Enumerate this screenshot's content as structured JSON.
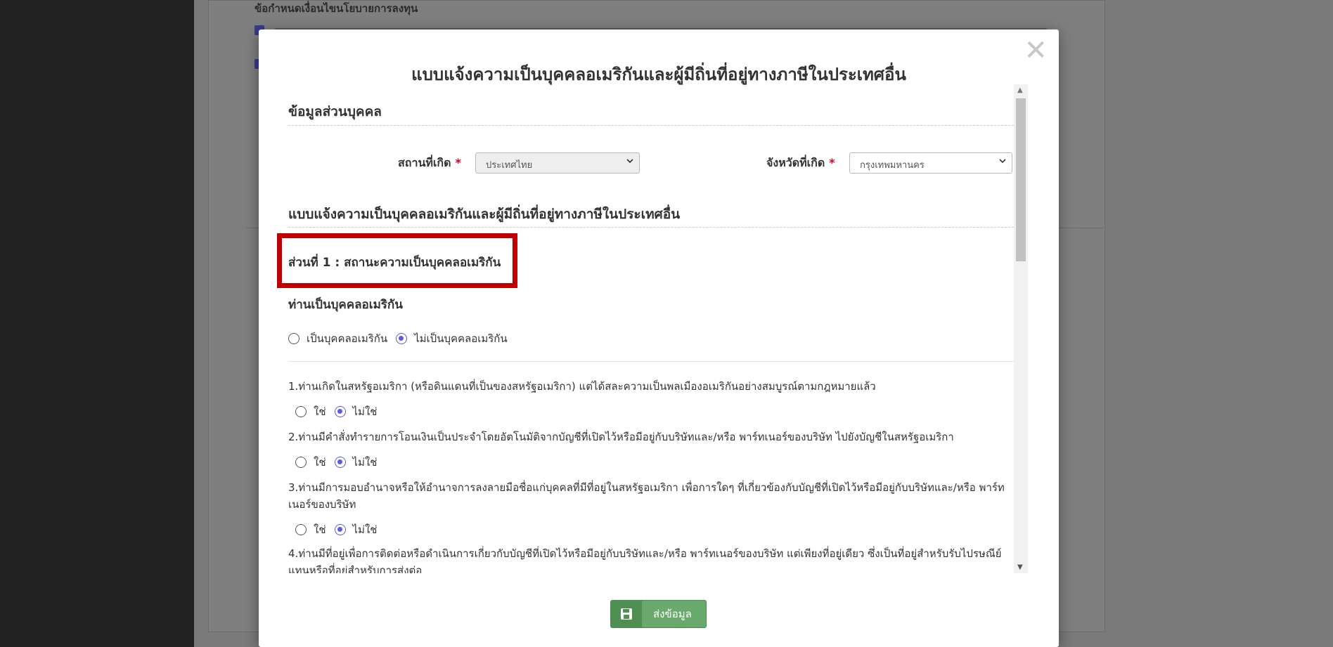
{
  "background": {
    "heading": "ข้อกำหนดเงื่อนไขนโยบายการลงทุน"
  },
  "modal": {
    "title": "แบบแจ้งความเป็นบุคคลอเมริกันและผู้มีถิ่นที่อยู่ทางภาษีในประเทศอื่น",
    "close_symbol": "✕",
    "personal_section_title": "ข้อมูลส่วนบุคคล",
    "birth_place": {
      "label": "สถานที่เกิด",
      "value": "ประเทศไทย"
    },
    "birth_province": {
      "label": "จังหวัดที่เกิด",
      "value": "กรุงเทพมหานคร"
    },
    "required_marker": "*",
    "fatca_section_title": "แบบแจ้งความเป็นบุคคลอเมริกันและผู้มีถิ่นที่อยู่ทางภาษีในประเทศอื่น",
    "part1_title": "ส่วนที่ 1 : สถานะความเป็นบุคคลอเมริกัน",
    "us_person_question": "ท่านเป็นบุคคลอเมริกัน",
    "us_person_options": [
      "เป็นบุคคลอเมริกัน",
      "ไม่เป็นบุคคลอเมริกัน"
    ],
    "us_person_selected": 1,
    "yes_label": "ใช่",
    "no_label": "ไม่ใช่",
    "questions": [
      {
        "text": "1.ท่านเกิดในสหรัฐอเมริกา (หรือดินแดนที่เป็นของสหรัฐอเมริกา) แต่ได้สละความเป็นพลเมืองอเมริกันอย่างสมบูรณ์ตามกฎหมายแล้ว",
        "answer": "ไม่ใช่"
      },
      {
        "text": "2.ท่านมีคำสั่งทำรายการโอนเงินเป็นประจำโดยอัตโนมัติจากบัญชีที่เปิดไว้หรือมีอยู่กับบริษัทและ/หรือ พาร์ทเนอร์ของบริษัท ไปยังบัญชีในสหรัฐอเมริกา",
        "answer": "ไม่ใช่"
      },
      {
        "text": "3.ท่านมีการมอบอำนาจหรือให้อำนาจการลงลายมือชื่อแก่บุคคลที่มีที่อยู่ในสหรัฐอเมริกา เพื่อการใดๆ ที่เกี่ยวข้องกับบัญชีที่เปิดไว้หรือมีอยู่กับบริษัทและ/หรือ พาร์ทเนอร์ของบริษัท",
        "answer": "ไม่ใช่"
      },
      {
        "text": "4.ท่านมีที่อยู่เพื่อการติดต่อหรือดำเนินการเกี่ยวกับบัญชีที่เปิดไว้หรือมีอยู่กับบริษัทและ/หรือ พาร์ทเนอร์ของบริษัท แต่เพียงที่อยู่เดียว ซึ่งเป็นที่อยู่สำหรับรับไปรษณีย์แทนหรือที่อยู่สำหรับการส่งต่อ",
        "answer": ""
      }
    ],
    "submit_label": "ส่งข้อมูล"
  },
  "colors": {
    "highlight": "#c00000",
    "accent_radio": "#5b5be0",
    "submit_bg": "#6aa96c",
    "required": "#d9001b"
  },
  "icons": {
    "close": "close-icon",
    "select_chevron": "chevron-down-icon",
    "submit": "floppy-disk-icon"
  }
}
